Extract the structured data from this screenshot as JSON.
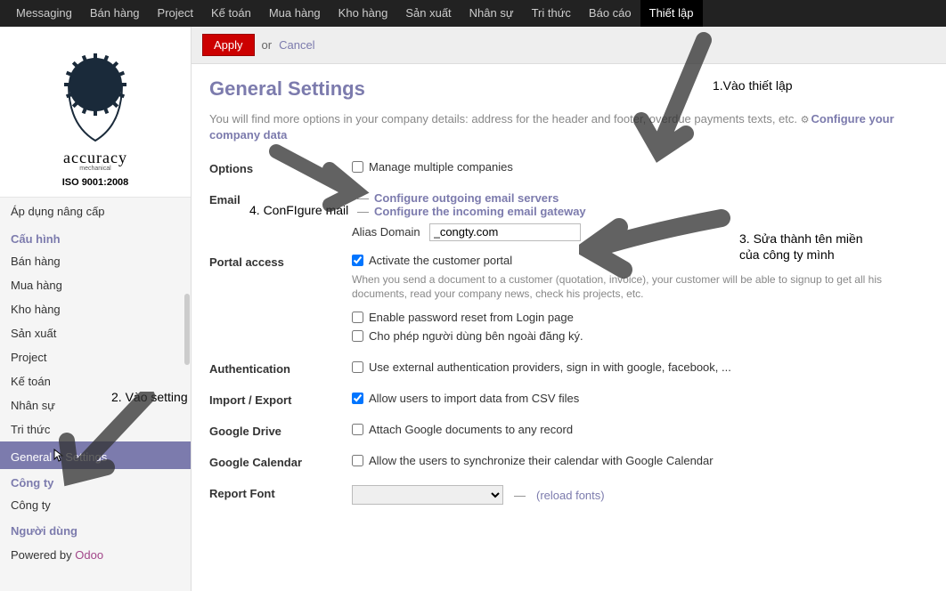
{
  "top_menu": {
    "items": [
      "Messaging",
      "Bán hàng",
      "Project",
      "Kế toán",
      "Mua hàng",
      "Kho hàng",
      "Sản xuất",
      "Nhân sự",
      "Tri thức",
      "Báo cáo",
      "Thiết lập"
    ],
    "active": "Thiết lập"
  },
  "logo": {
    "name": "accuracy",
    "sub": "mechanical",
    "iso": "ISO 9001:2008"
  },
  "sidebar": {
    "upgrade": "Áp dụng nâng cấp",
    "groups": [
      {
        "title": "Cấu hình",
        "items": [
          "Bán hàng",
          "Mua hàng",
          "Kho hàng",
          "Sản xuất",
          "Project",
          "Kế toán",
          "Nhân sự",
          "Tri thức",
          "General Settings"
        ]
      },
      {
        "title": "Công ty",
        "items": [
          "Công ty"
        ]
      },
      {
        "title": "Người dùng",
        "items": []
      }
    ],
    "selected": "General Settings",
    "powered_prefix": "Powered by ",
    "powered_brand": "Odoo"
  },
  "actions": {
    "apply": "Apply",
    "or": "or",
    "cancel": "Cancel"
  },
  "page": {
    "title": "General Settings",
    "intro_prefix": "You will find more options in your company details: address for the header and footer, overdue payments texts, etc. ",
    "configure_company": "Configure your company data"
  },
  "form": {
    "options": {
      "label": "Options",
      "manage_multi": "Manage multiple companies",
      "manage_multi_checked": false
    },
    "email": {
      "label": "Email",
      "outgoing": "Configure outgoing email servers",
      "incoming": "Configure the incoming email gateway",
      "alias_label": "Alias Domain",
      "alias_value": "_congty.com"
    },
    "portal": {
      "label": "Portal access",
      "activate": "Activate the customer portal",
      "activate_checked": true,
      "activate_help": "When you send a document to a customer (quotation, invoice), your customer will be able to signup to get all his documents, read your company news, check his projects, etc.",
      "reset": "Enable password reset from Login page",
      "reset_checked": false,
      "external": "Cho phép người dùng bên ngoài đăng ký.",
      "external_checked": false
    },
    "auth": {
      "label": "Authentication",
      "ext_providers": "Use external authentication providers, sign in with google, facebook, ...",
      "checked": false
    },
    "import_export": {
      "label": "Import / Export",
      "csv": "Allow users to import data from CSV files",
      "checked": true
    },
    "gdrive": {
      "label": "Google Drive",
      "attach": "Attach Google documents to any record",
      "checked": false
    },
    "gcal": {
      "label": "Google Calendar",
      "sync": "Allow the users to synchronize their calendar with Google Calendar",
      "checked": false
    },
    "font": {
      "label": "Report Font",
      "reload": "(reload fonts)"
    }
  },
  "annotations": {
    "a1": "1.Vào thiết lập",
    "a2": "2. Vào setting",
    "a3_l1": "3. Sửa thành tên miền",
    "a3_l2": "của công ty mình",
    "a4": "4. ConFIgure mail"
  }
}
